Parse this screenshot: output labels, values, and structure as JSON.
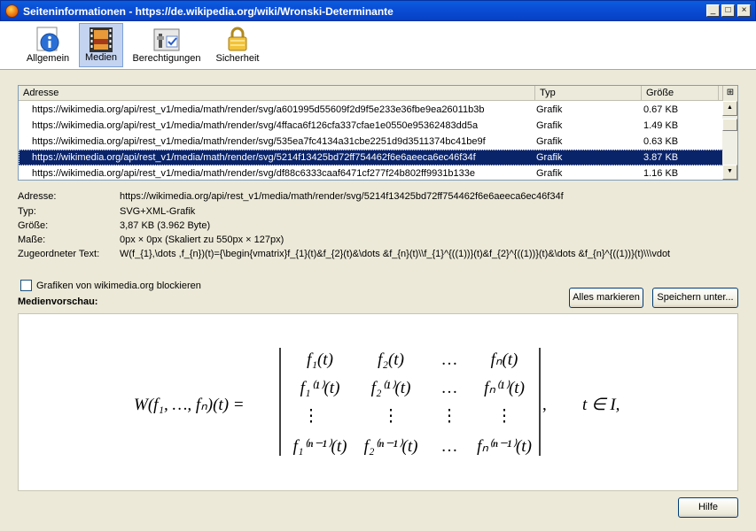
{
  "window": {
    "title": "Seiteninformationen - https://de.wikipedia.org/wiki/Wronski-Determinante",
    "controls": {
      "minimize": "_",
      "maximize": "□",
      "close": "×"
    }
  },
  "tabs": [
    {
      "label": "Allgemein",
      "icon": "info-icon"
    },
    {
      "label": "Medien",
      "icon": "media-icon",
      "active": true
    },
    {
      "label": "Berechtigungen",
      "icon": "permissions-icon"
    },
    {
      "label": "Sicherheit",
      "icon": "lock-icon"
    }
  ],
  "table": {
    "columns": [
      "Adresse",
      "Typ",
      "Größe"
    ],
    "rows": [
      {
        "address": "https://wikimedia.org/api/rest_v1/media/math/render/svg/a601995d55609f2d9f5e233e36fbe9ea26011b3b",
        "type": "Grafik",
        "size": "0.67 KB"
      },
      {
        "address": "https://wikimedia.org/api/rest_v1/media/math/render/svg/4ffaca6f126cfa337cfae1e0550e95362483dd5a",
        "type": "Grafik",
        "size": "1.49 KB"
      },
      {
        "address": "https://wikimedia.org/api/rest_v1/media/math/render/svg/535ea7fc4134a31cbe2251d9d3511374bc41be9f",
        "type": "Grafik",
        "size": "0.63 KB"
      },
      {
        "address": "https://wikimedia.org/api/rest_v1/media/math/render/svg/5214f13425bd72ff754462f6e6aeeca6ec46f34f",
        "type": "Grafik",
        "size": "3.87 KB",
        "selected": true
      },
      {
        "address": "https://wikimedia.org/api/rest_v1/media/math/render/svg/df88c6333caaf6471cf277f24b802ff9931b133e",
        "type": "Grafik",
        "size": "1.16 KB"
      }
    ]
  },
  "details": {
    "address_label": "Adresse:",
    "address": "https://wikimedia.org/api/rest_v1/media/math/render/svg/5214f13425bd72ff754462f6e6aeeca6ec46f34f",
    "type_label": "Typ:",
    "type": "SVG+XML-Grafik",
    "size_label": "Größe:",
    "size": "3,87 KB (3.962 Byte)",
    "dims_label": "Maße:",
    "dims": "0px × 0px (Skaliert zu 550px × 127px)",
    "alt_label": "Zugeordneter Text:",
    "alt": "W(f_{1},\\dots ,f_{n})(t)={\\begin{vmatrix}f_{1}(t)&f_{2}(t)&\\dots &f_{n}(t)\\\\f_{1}^{((1))}(t)&f_{2}^{((1))}(t)&\\dots &f_{n}^{((1))}(t)\\\\\\vdot"
  },
  "block_checkbox": {
    "label": "Grafiken von wikimedia.org blockieren",
    "checked": false
  },
  "preview_label": "Medienvorschau:",
  "buttons": {
    "select_all": "Alles markieren",
    "save_as": "Speichern unter...",
    "help": "Hilfe"
  },
  "formula": {
    "lhs": "W(f₁, …, fₙ)(t) =",
    "rows": [
      [
        "f₁(t)",
        "f₂(t)",
        "…",
        "fₙ(t)"
      ],
      [
        "f₁⁽¹⁾(t)",
        "f₂⁽¹⁾(t)",
        "…",
        "fₙ⁽¹⁾(t)"
      ],
      [
        "⋮",
        "⋮",
        "⋮",
        "⋮"
      ],
      [
        "f₁⁽ⁿ⁻¹⁾(t)",
        "f₂⁽ⁿ⁻¹⁾(t)",
        "…",
        "fₙ⁽ⁿ⁻¹⁾(t)"
      ]
    ],
    "trailing_comma": ",",
    "condition": "t ∈ I,"
  }
}
